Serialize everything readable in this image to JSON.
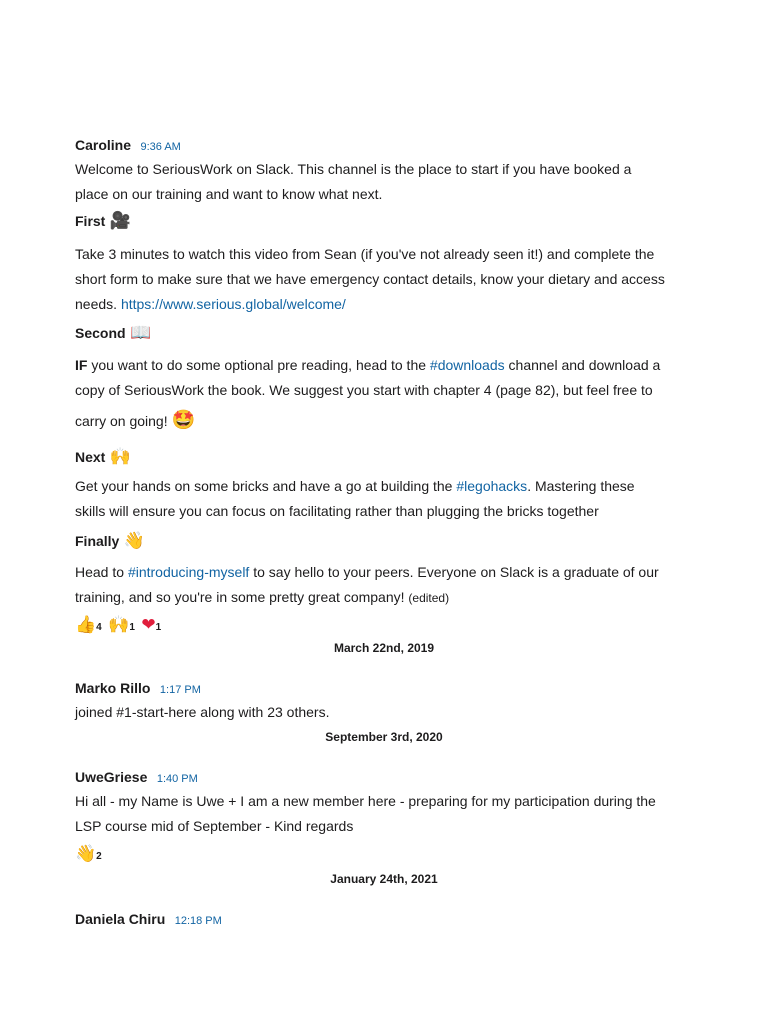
{
  "messages": {
    "caroline": {
      "name": "Caroline",
      "time": "9:36 AM",
      "intro_line1": "Welcome to SeriousWork on Slack.  This channel is the place to start if you have booked a",
      "intro_line2": "place on our training and want to know what next.",
      "first": {
        "heading": "First",
        "icon": "video-camera-icon",
        "line1": "Take 3 minutes to watch this video from Sean (if you've not already seen it!) and complete the",
        "line2": "short form to make sure that we have emergency contact details, know your dietary and access",
        "line3_prefix": "needs. ",
        "link": "https://www.serious.global/welcome/"
      },
      "second": {
        "heading": "Second",
        "icon": "open-book-icon",
        "bold_if": "IF",
        "line1_a": " you want to do some optional pre reading, head to the ",
        "channel": "#downloads",
        "line1_b": " channel and download a",
        "line2": "copy of SeriousWork the book. We suggest you start with chapter 4 (page 82), but feel free to",
        "line3": "carry on going! "
      },
      "next": {
        "heading": "Next",
        "icon": "raised-hands-icon",
        "line1_a": "Get your hands on some bricks and have a go at building the ",
        "channel": "#legohacks",
        "line1_b": ". Mastering these",
        "line2": "skills will ensure you can focus on facilitating rather than plugging the bricks together"
      },
      "finally": {
        "heading": "Finally",
        "icon": "waving-hand-icon",
        "line1_a": "Head to ",
        "channel": "#introducing-myself",
        "line1_b": " to say hello to your peers.  Everyone on Slack is a graduate of our",
        "line2": "training, and so you're in some pretty great company! ",
        "edited": "(edited)"
      },
      "reactions": [
        {
          "icon": "thumbs-up-icon",
          "count": "4"
        },
        {
          "icon": "raised-hands-icon",
          "count": "1"
        },
        {
          "icon": "heart-icon",
          "count": "1"
        }
      ]
    },
    "marko": {
      "date": "March 22nd, 2019",
      "name": "Marko Rillo",
      "time": "1:17 PM",
      "text": "joined #1-start-here along with 23 others."
    },
    "uwe": {
      "date": "September 3rd, 2020",
      "name": "UweGriese",
      "time": "1:40 PM",
      "line1": "Hi all - my Name is Uwe + I am a new member here - preparing for my participation during the",
      "line2": "LSP course mid of September - Kind regards",
      "reaction": {
        "icon": "waving-hand-icon",
        "count": "2"
      }
    },
    "daniela": {
      "date": "January 24th, 2021",
      "name": "Daniela Chiru",
      "time": "12:18 PM"
    }
  }
}
